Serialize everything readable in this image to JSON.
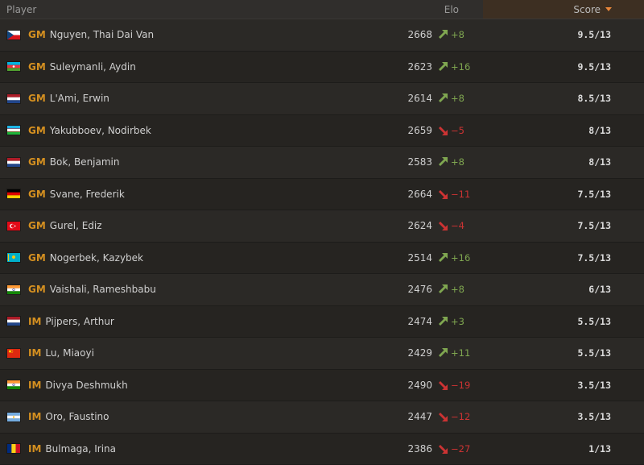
{
  "header": {
    "player": "Player",
    "elo": "Elo",
    "score": "Score"
  },
  "colors": {
    "title": "#d59020",
    "up": "#7fa650",
    "down": "#cc3333",
    "score_header_bg": "#3d2f22"
  },
  "rows": [
    {
      "flag": "cz",
      "title": "GM",
      "name": "Nguyen, Thai Dai Van",
      "rating": "2668",
      "dir": "up",
      "delta": "+8",
      "score": "9.5/13"
    },
    {
      "flag": "az",
      "title": "GM",
      "name": "Suleymanli, Aydin",
      "rating": "2623",
      "dir": "up",
      "delta": "+16",
      "score": "9.5/13"
    },
    {
      "flag": "nl",
      "title": "GM",
      "name": "L'Ami, Erwin",
      "rating": "2614",
      "dir": "up",
      "delta": "+8",
      "score": "8.5/13"
    },
    {
      "flag": "uz",
      "title": "GM",
      "name": "Yakubboev, Nodirbek",
      "rating": "2659",
      "dir": "down",
      "delta": "−5",
      "score": "8/13"
    },
    {
      "flag": "nl",
      "title": "GM",
      "name": "Bok, Benjamin",
      "rating": "2583",
      "dir": "up",
      "delta": "+8",
      "score": "8/13"
    },
    {
      "flag": "de",
      "title": "GM",
      "name": "Svane, Frederik",
      "rating": "2664",
      "dir": "down",
      "delta": "−11",
      "score": "7.5/13"
    },
    {
      "flag": "tr",
      "title": "GM",
      "name": "Gurel, Ediz",
      "rating": "2624",
      "dir": "down",
      "delta": "−4",
      "score": "7.5/13"
    },
    {
      "flag": "kz",
      "title": "GM",
      "name": "Nogerbek, Kazybek",
      "rating": "2514",
      "dir": "up",
      "delta": "+16",
      "score": "7.5/13"
    },
    {
      "flag": "in",
      "title": "GM",
      "name": "Vaishali, Rameshbabu",
      "rating": "2476",
      "dir": "up",
      "delta": "+8",
      "score": "6/13"
    },
    {
      "flag": "nl",
      "title": "IM",
      "name": "Pijpers, Arthur",
      "rating": "2474",
      "dir": "up",
      "delta": "+3",
      "score": "5.5/13"
    },
    {
      "flag": "cn",
      "title": "IM",
      "name": "Lu, Miaoyi",
      "rating": "2429",
      "dir": "up",
      "delta": "+11",
      "score": "5.5/13"
    },
    {
      "flag": "in",
      "title": "IM",
      "name": "Divya Deshmukh",
      "rating": "2490",
      "dir": "down",
      "delta": "−19",
      "score": "3.5/13"
    },
    {
      "flag": "ar",
      "title": "IM",
      "name": "Oro, Faustino",
      "rating": "2447",
      "dir": "down",
      "delta": "−12",
      "score": "3.5/13"
    },
    {
      "flag": "ro",
      "title": "IM",
      "name": "Bulmaga, Irina",
      "rating": "2386",
      "dir": "down",
      "delta": "−27",
      "score": "1/13"
    }
  ]
}
